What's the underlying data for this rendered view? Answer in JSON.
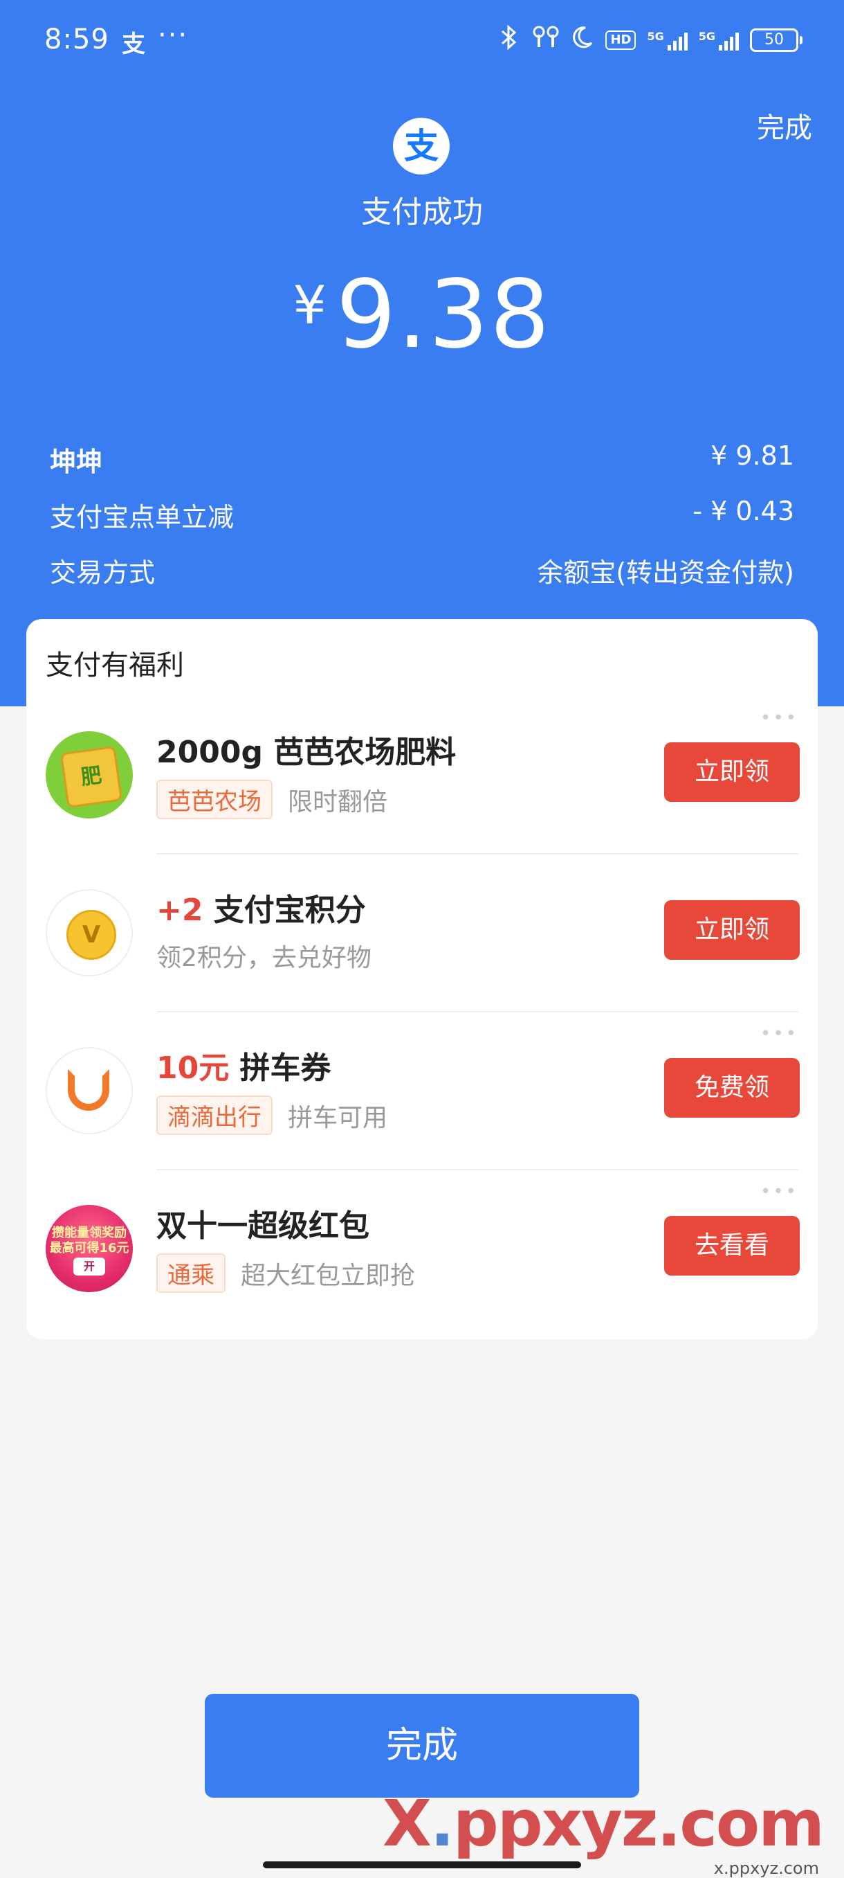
{
  "status_bar": {
    "time": "8:59",
    "app_glyph": "支",
    "more": "···",
    "icons": [
      "bluetooth-icon",
      "earbuds-icon",
      "moon-icon"
    ],
    "hd_label": "HD",
    "network_label_1": "5G",
    "network_label_2": "5G",
    "battery": "50"
  },
  "header": {
    "done_label": "完成",
    "logo_glyph": "支",
    "status_text": "支付成功",
    "currency": "¥",
    "amount": "9.38"
  },
  "details": {
    "payee_label": "坤坤",
    "payee_value": "¥ 9.81",
    "discount_label": "支付宝点单立减",
    "discount_value": "- ¥ 0.43",
    "method_label": "交易方式",
    "method_value": "余额宝(转出资金付款)"
  },
  "benefits": {
    "title": "支付有福利",
    "items": [
      {
        "title_accent": "",
        "title": "2000g 芭芭农场肥料",
        "tag": "芭芭农场",
        "desc": "限时翻倍",
        "cta": "立即领",
        "icon": "farm-fertilizer-icon",
        "icon_text": "肥"
      },
      {
        "title_accent": "+2",
        "title": " 支付宝积分",
        "tag": "",
        "desc": "领2积分，去兑好物",
        "cta": "立即领",
        "icon": "points-coin-icon",
        "icon_text": "V"
      },
      {
        "title_accent": "10元",
        "title": " 拼车券",
        "tag": "滴滴出行",
        "desc": "拼车可用",
        "cta": "免费领",
        "icon": "didi-icon",
        "icon_text": ""
      },
      {
        "title_accent": "",
        "title": "双十一超级红包",
        "tag": "通乘",
        "desc": "超大红包立即抢",
        "cta": "去看看",
        "icon": "red-packet-icon",
        "icon_text": "攒能量领奖励 最高可得16元",
        "icon_badge": "开"
      }
    ]
  },
  "footer": {
    "done_label": "完成"
  },
  "watermark": {
    "brand_left": "X",
    "brand_dot": ".",
    "brand_right": "ppxyz.com",
    "small": "x.ppxyz.com"
  }
}
